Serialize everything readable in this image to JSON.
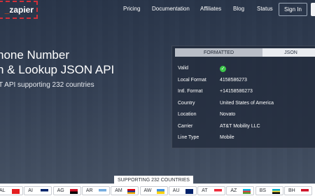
{
  "nav": {
    "logo_text": "zapier",
    "links": [
      "Pricing",
      "Documentation",
      "Affiliates",
      "Blog",
      "Status"
    ],
    "signin": "Sign In"
  },
  "hero": {
    "title_line1": "hone Number",
    "title_line2": "n & Lookup JSON API",
    "subtitle": "T API supporting 232 countries"
  },
  "panel": {
    "tabs": [
      "FORMATTED",
      "JSON"
    ],
    "rows": [
      {
        "key": "Valid",
        "value": "",
        "icon": "check-icon"
      },
      {
        "key": "Local Format",
        "value": "4158586273"
      },
      {
        "key": "Intl. Format",
        "value": "+14158586273"
      },
      {
        "key": "Country",
        "value": "United States of America"
      },
      {
        "key": "Location",
        "value": "Novato"
      },
      {
        "key": "Carrier",
        "value": "AT&T Mobility LLC"
      },
      {
        "key": "Line Type",
        "value": "Mobile"
      }
    ]
  },
  "supporting_label": "SUPPORTING 232 COUNTRIES",
  "flags": [
    {
      "code": "AL",
      "colors": [
        "#e41e20"
      ]
    },
    {
      "code": "AI",
      "colors": [
        "#012169",
        "#ffffff"
      ]
    },
    {
      "code": "AG",
      "colors": [
        "#ce1126",
        "#000000"
      ]
    },
    {
      "code": "AR",
      "colors": [
        "#74acdf",
        "#ffffff"
      ]
    },
    {
      "code": "AM",
      "colors": [
        "#d90012",
        "#0033a0",
        "#f2a800"
      ]
    },
    {
      "code": "AW",
      "colors": [
        "#418fde",
        "#ffd100"
      ]
    },
    {
      "code": "AU",
      "colors": [
        "#012169"
      ]
    },
    {
      "code": "AT",
      "colors": [
        "#ed2939",
        "#ffffff"
      ]
    },
    {
      "code": "AZ",
      "colors": [
        "#00b5e2",
        "#ef3340",
        "#509e2f"
      ]
    },
    {
      "code": "BS",
      "colors": [
        "#00abc9",
        "#fae042",
        "#000000"
      ]
    },
    {
      "code": "BH",
      "colors": [
        "#ce1126",
        "#ffffff"
      ]
    }
  ]
}
